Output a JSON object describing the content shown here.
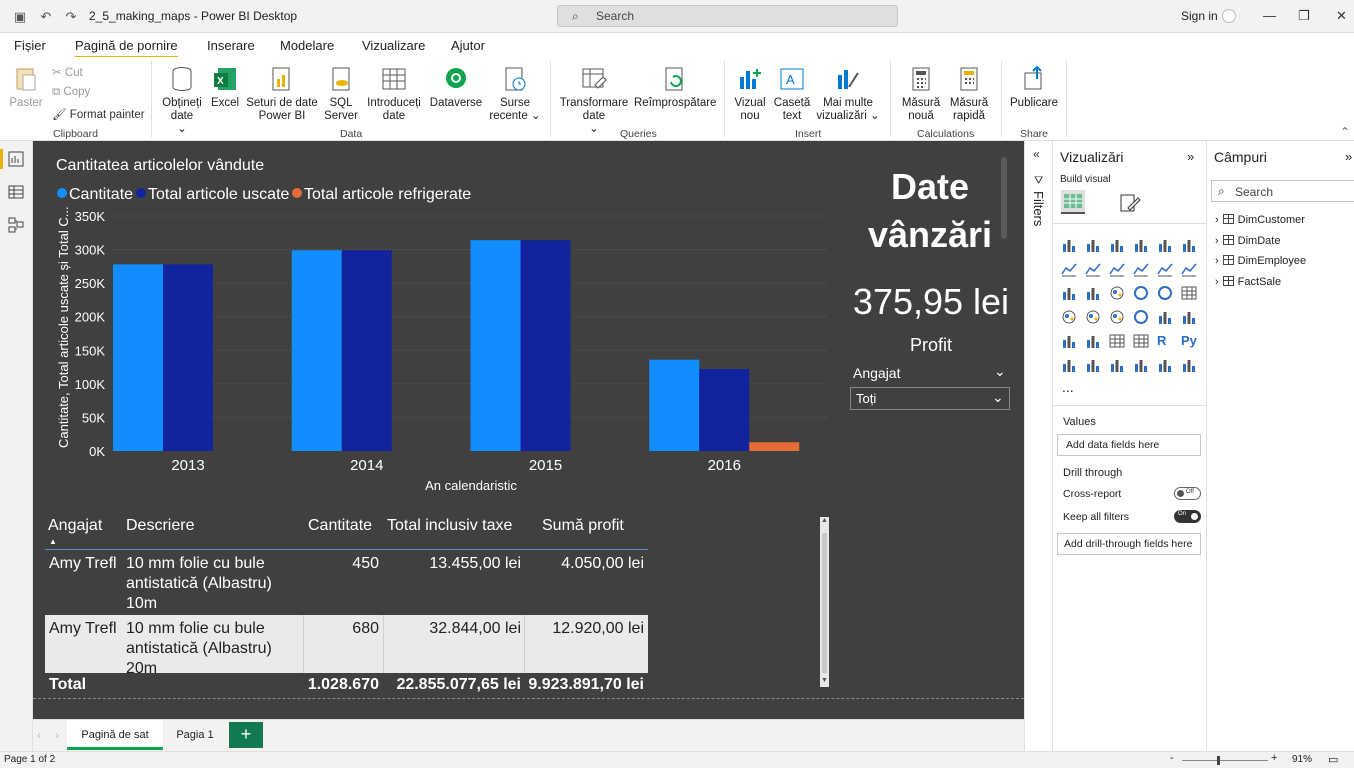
{
  "titlebar": {
    "doc_title": "2_5_making_maps - Power BI Desktop",
    "search_placeholder": "Search",
    "signin": "Sign in"
  },
  "menu": [
    "Fișier",
    "Pagină de pornire",
    "Inserare",
    "Modelare",
    "Vizualizare",
    "Ajutor"
  ],
  "ribbon": {
    "paste": "Paster",
    "cut": "Cut",
    "copy": "Copy",
    "format_painter": "Format painter",
    "get_data": "Obținеți date",
    "excel": "Excel",
    "datasets": "Seturi de date Power BI",
    "sql": "SQL Server",
    "enter_data": "Introduceți date",
    "dataverse": "Dataverse",
    "recent": "Surse recente",
    "transform": "Transformare date",
    "refresh": "Reîmprospătare",
    "new_visual": "Vizual nou",
    "textbox": "Casetă text",
    "more_visuals": "Mai multe vizualizări",
    "new_measure": "Măsură nouă",
    "quick_measure": "Măsură rapidă",
    "publish": "Publicare",
    "groups": {
      "clipboard": "Clipboard",
      "data": "Data",
      "queries": "Queries",
      "insert": "Insert",
      "calculations": "Calculations",
      "share": "Share"
    }
  },
  "chart_data": {
    "type": "bar",
    "title": "Cantitatea articolelor vândute",
    "xlabel": "An calendaristic",
    "ylabel": "Cantitate, Total articole uscate și Total C...",
    "ylim": [
      0,
      350000
    ],
    "yticks": [
      "0K",
      "50K",
      "100K",
      "150K",
      "200K",
      "250K",
      "300K",
      "350K"
    ],
    "categories": [
      "2013",
      "2014",
      "2015",
      "2016"
    ],
    "series": [
      {
        "name": "Cantitate",
        "color": "#118dff",
        "values": [
          278000,
          299000,
          314000,
          136000
        ]
      },
      {
        "name": "Total articole uscate",
        "color": "#12239e",
        "values": [
          278000,
          299000,
          314000,
          122000
        ]
      },
      {
        "name": "Total articole refrigerate",
        "color": "#e66c37",
        "values": [
          0,
          0,
          0,
          13000
        ]
      }
    ]
  },
  "card": {
    "title": "Date vânzări",
    "value": "375,95 lei",
    "label": "Profit"
  },
  "slicer": {
    "label": "Angajat",
    "value": "Toți"
  },
  "table": {
    "headers": [
      "Angajat",
      "Descriere",
      "Cantitate",
      "Total inclusiv taxe",
      "Sumă profit"
    ],
    "rows": [
      {
        "employee": "Amy Trefl",
        "desc1": "10 mm folie cu bule",
        "desc2": "antistatică (Albastru)",
        "desc3": "10m",
        "qty": "450",
        "total": "13.455,00 lei",
        "profit": "4.050,00 lei"
      },
      {
        "employee": "Amy Trefl",
        "desc1": "10 mm folie cu bule",
        "desc2": "antistatică (Albastru)",
        "desc3": "20m",
        "qty": "680",
        "total": "32.844,00 lei",
        "profit": "12.920,00 lei"
      }
    ],
    "total": {
      "label": "Total",
      "qty": "1.028.670",
      "total": "22.855.077,65 lei",
      "profit": "9.923.891,70 lei"
    }
  },
  "filters_label": "Filters",
  "viz_pane": {
    "title": "Vizualizări",
    "build": "Build visual",
    "values": "Values",
    "add_fields": "Add data fields here",
    "drill": "Drill through",
    "cross": "Cross-report",
    "cross_state": "Off",
    "keep": "Keep all filters",
    "keep_state": "On",
    "add_drill": "Add drill-through fields here",
    "more": "..."
  },
  "fields_pane": {
    "title": "Câmpuri",
    "search": "Search",
    "tables": [
      "DimCustomer",
      "DimDate",
      "DimEmployee",
      "FactSale"
    ]
  },
  "pages": {
    "active": "Pagină de sat",
    "other": "Pagia 1",
    "add": "+"
  },
  "status": {
    "page": "Page 1 of 2",
    "zoom": "91%"
  }
}
